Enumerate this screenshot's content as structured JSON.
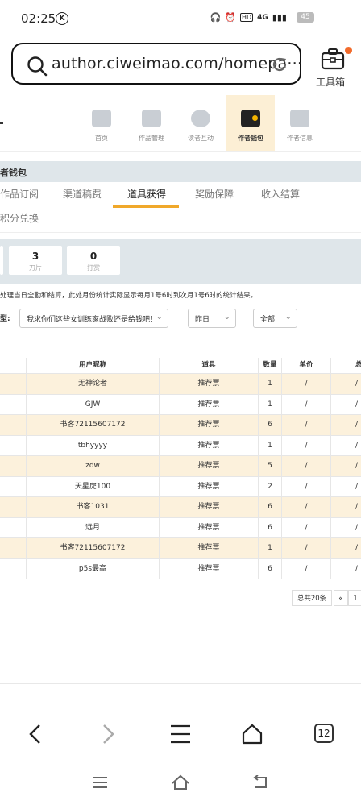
{
  "status": {
    "time": "02:25",
    "k_badge": "K",
    "hd": "HD",
    "signal": "4G",
    "battery": "45"
  },
  "browser": {
    "url": "author.ciweimao.com/homepa···",
    "toolbox_label": "工具箱",
    "tab_count": "12"
  },
  "nav": {
    "items": [
      "首页",
      "作品管理",
      "读者互动",
      "作者钱包",
      "作者信息"
    ],
    "active": "作者钱包"
  },
  "section_title": "者钱包",
  "tabs": [
    "作品订阅",
    "渠道稿费",
    "道具获得",
    "奖励保障",
    "收入结算"
  ],
  "tab_active": "道具获得",
  "tab_row2": "积分兑换",
  "stats": [
    {
      "value": "3",
      "label": "刀片"
    },
    {
      "value": "0",
      "label": "打赏"
    }
  ],
  "notice": "处理当日全勤和结算，此处月份统计实际显示每月1号6时到次月1号6时的统计结果。",
  "filters": {
    "label": "型:",
    "book": "我求你们这些女训练家战败还是给钱吧！",
    "date": "昨日",
    "type": "全部"
  },
  "table": {
    "headers": [
      "用户昵称",
      "道具",
      "数量",
      "单价",
      "总"
    ],
    "rows": [
      [
        "无神论者",
        "推荐票",
        "1",
        "/",
        "/"
      ],
      [
        "GJW",
        "推荐票",
        "1",
        "/",
        "/"
      ],
      [
        "书客72115607172",
        "推荐票",
        "6",
        "/",
        "/"
      ],
      [
        "tbhyyyy",
        "推荐票",
        "1",
        "/",
        "/"
      ],
      [
        "zdw",
        "推荐票",
        "5",
        "/",
        "/"
      ],
      [
        "天星虎100",
        "推荐票",
        "2",
        "/",
        "/"
      ],
      [
        "书客1031",
        "推荐票",
        "6",
        "/",
        "/"
      ],
      [
        "远月",
        "推荐票",
        "6",
        "/",
        "/"
      ],
      [
        "书客72115607172",
        "推荐票",
        "1",
        "/",
        "/"
      ],
      [
        "p5s最高",
        "推荐票",
        "6",
        "/",
        "/"
      ]
    ]
  },
  "pagination": {
    "total": "总共20条",
    "prev": "«",
    "page": "1"
  }
}
